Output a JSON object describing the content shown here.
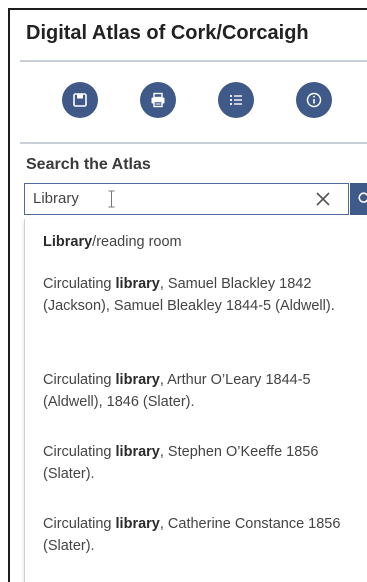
{
  "title": "Digital Atlas of Cork/Corcaigh",
  "toolbar": {
    "buttons": [
      {
        "name": "save",
        "icon": "save-icon"
      },
      {
        "name": "print",
        "icon": "print-icon"
      },
      {
        "name": "list",
        "icon": "list-icon"
      },
      {
        "name": "info",
        "icon": "info-icon"
      }
    ]
  },
  "search": {
    "label": "Search the Atlas",
    "value": "Library",
    "placeholder": ""
  },
  "suggestions": [
    {
      "pre": "",
      "match": "Library",
      "post": "/reading room"
    },
    {
      "pre": "Circulating ",
      "match": "library",
      "post": ", Samuel Blackley 1842 (Jackson), Samuel Bleakley 1844-5 (Aldwell)."
    },
    {
      "pre": "Circulating ",
      "match": "library",
      "post": ", Arthur O’Leary 1844-5 (Aldwell), 1846 (Slater)."
    },
    {
      "pre": "Circulating ",
      "match": "library",
      "post": ", Stephen O’Keeffe 1856 (Slater)."
    },
    {
      "pre": "Circulating ",
      "match": "library",
      "post": ", Catherine Constance 1856 (Slater)."
    }
  ],
  "colors": {
    "accent": "#3f5a89",
    "rule": "#c9cfd9",
    "border": "#4d6ba0"
  }
}
